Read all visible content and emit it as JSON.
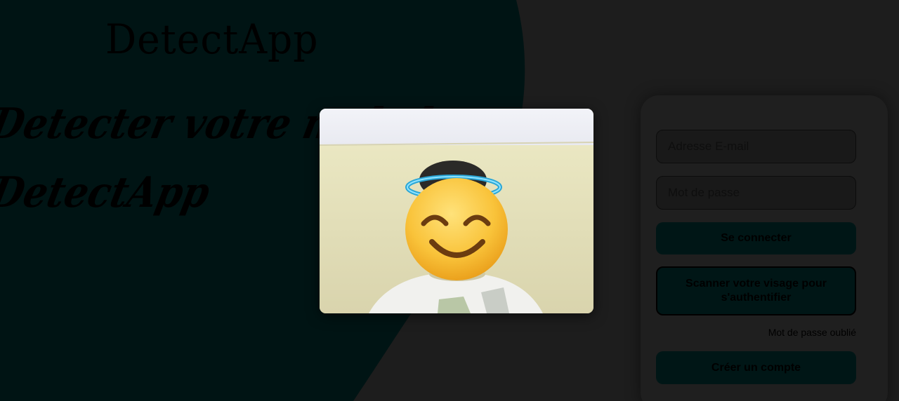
{
  "brand": {
    "logo": "DetectApp"
  },
  "hero": {
    "line1": "Detecter votre malad",
    "line2": "DetectApp"
  },
  "login_form": {
    "email_placeholder": "Adresse E-mail",
    "password_placeholder": "Mot de passe",
    "login_button": "Se connecter",
    "face_scan_button": "Scanner votre visage pour s'authentifier",
    "forgot_password": "Mot de passe oublié",
    "create_account_button": "Créer un compte"
  },
  "camera_modal": {
    "overlay_icon": "smiling-face-with-halo-emoji"
  },
  "colors": {
    "page_background": "#1d1d1d",
    "left_panel": "#001414",
    "button_fill": "#001616"
  }
}
